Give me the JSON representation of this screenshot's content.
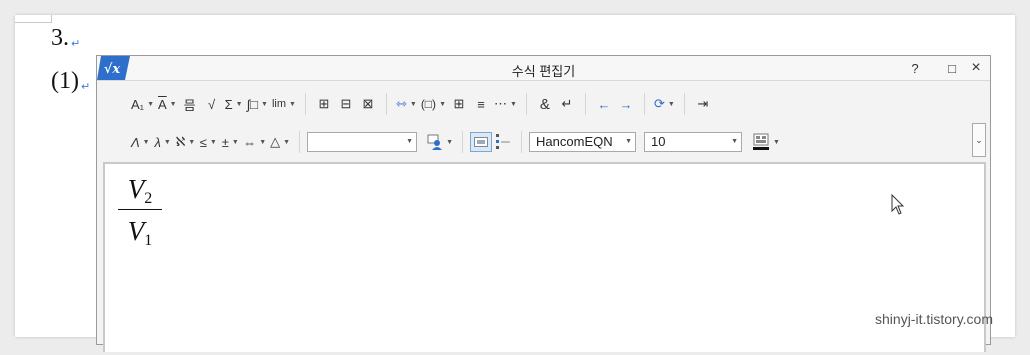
{
  "document": {
    "line1": "3.",
    "line2": "(1)",
    "para_mark": "↵"
  },
  "editor": {
    "title": "수식 편집기",
    "app_icon_label": "√x",
    "help_label": "?",
    "maximize_label": "□",
    "close_label": "×",
    "toolbar1": {
      "subscript_label": "A₁",
      "decoration_label": "A",
      "fraction_label": "믐",
      "root_label": "√",
      "sum_label": "Σ",
      "integral_label": "∫□",
      "limit_label": "lim",
      "matrix_labels": [
        "⊞",
        "⊟",
        "⊠"
      ],
      "align_label": "⇿",
      "paren_label": "(□)",
      "grid_labels": [
        "⊞",
        "≡",
        "⋯"
      ],
      "ampersand_label": "&",
      "enter_label": "↵",
      "left_arrow_label": "←",
      "right_arrow_label": "→",
      "refresh_label": "⟳",
      "insert_label": "⇥"
    },
    "toolbar2": {
      "greek_upper_label": "Λ",
      "greek_lower_label": "λ",
      "hebrew_label": "ℵ",
      "relation_label": "≤",
      "operator_label": "±",
      "arrow_label": "⇔",
      "misc_label": "△",
      "font_name": "HancomEQN",
      "font_size": "10",
      "color_label": "A"
    }
  },
  "equation": {
    "numerator": "V",
    "numerator_sub": "2",
    "denominator": "V",
    "denominator_sub": "1"
  },
  "watermark": "shinyj-it.tistory.com"
}
